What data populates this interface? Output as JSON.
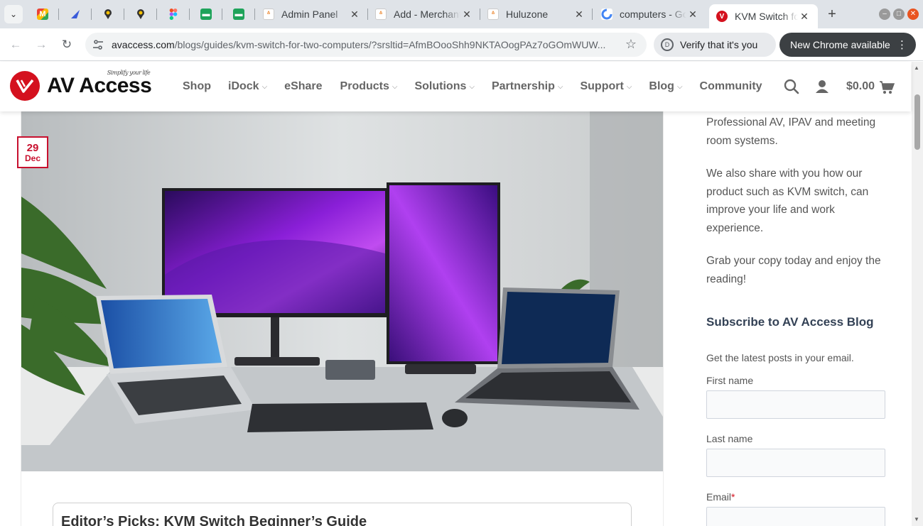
{
  "browser": {
    "tabs": [
      {
        "title": "Admin Panel",
        "active": false
      },
      {
        "title": "Add - Merchant",
        "active": false
      },
      {
        "title": "Huluzone",
        "active": false
      },
      {
        "title": "computers - Google Search",
        "active": false
      },
      {
        "title": "KVM Switch for Two Computers",
        "active": true
      }
    ],
    "new_tab": "+",
    "close_glyph": "✕",
    "url_host": "avaccess.com",
    "url_path": "/blogs/guides/kvm-switch-for-two-computers/?srsltid=AfmBOooShh9NKTAOogPAz7oGOmWUW...",
    "verify_label": "Verify that it's you",
    "update_label": "New Chrome available"
  },
  "site": {
    "logo_text": "AV Access",
    "logo_tagline": "Simplify your life",
    "menu": [
      {
        "label": "Shop",
        "has_dropdown": false
      },
      {
        "label": "iDock",
        "has_dropdown": true
      },
      {
        "label": "eShare",
        "has_dropdown": false
      },
      {
        "label": "Products",
        "has_dropdown": true
      },
      {
        "label": "Solutions",
        "has_dropdown": true
      },
      {
        "label": "Partnership",
        "has_dropdown": true
      },
      {
        "label": "Support",
        "has_dropdown": true
      },
      {
        "label": "Blog",
        "has_dropdown": true
      },
      {
        "label": "Community",
        "has_dropdown": false
      }
    ],
    "cart_amount": "$0.00",
    "accent_color": "#d4111e"
  },
  "post": {
    "date_day": "29",
    "date_month": "Dec",
    "editor_title": "Editor’s Picks: KVM Switch Beginner’s Guide"
  },
  "sidebar": {
    "p1": "Professional AV, IPAV and meeting room systems.",
    "p2": "We also share with you how our product such as KVM switch, can improve your life and work experience.",
    "p3": "Grab your copy today and enjoy the reading!",
    "subscribe_title": "Subscribe to AV Access Blog",
    "subscribe_desc": "Get the latest posts in your email.",
    "first_name_label": "First name",
    "last_name_label": "Last name",
    "email_label": "Email",
    "email_required": "*"
  }
}
